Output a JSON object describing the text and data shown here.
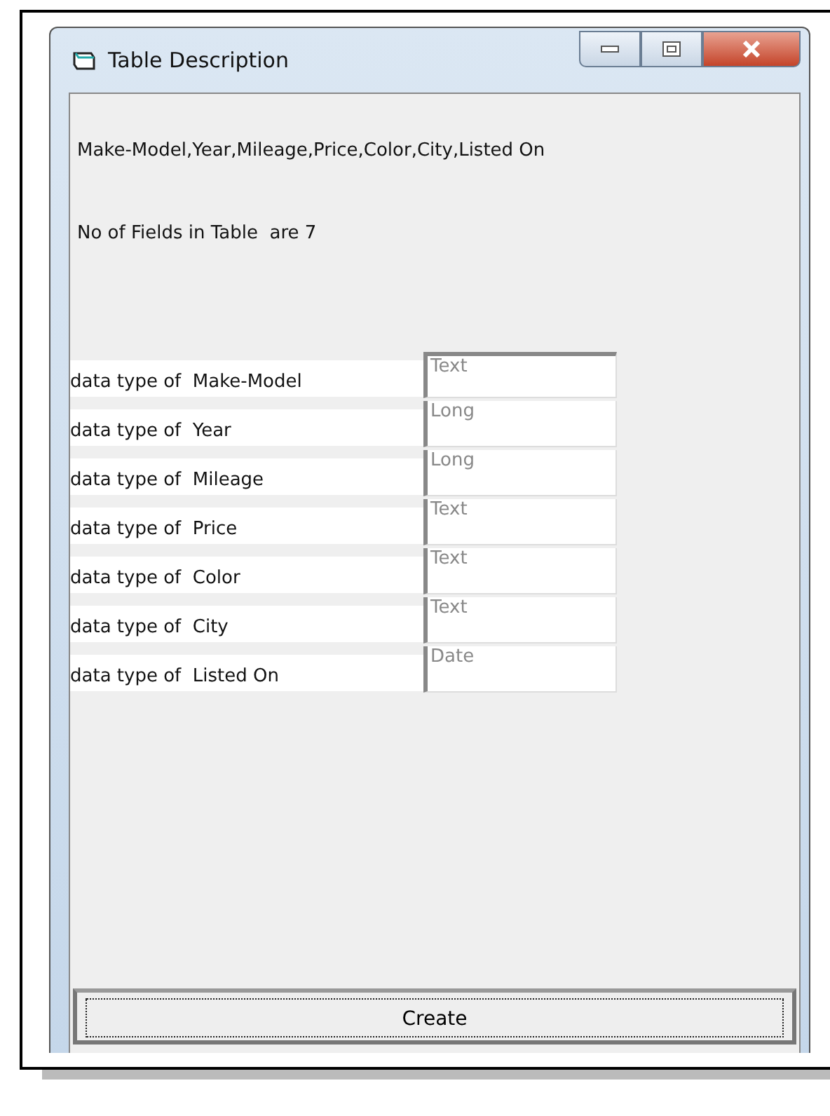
{
  "window": {
    "title": "Table Description"
  },
  "field_list": "Make-Model,Year,Mileage,Price,Color,City,Listed On",
  "field_count": "No of Fields in Table  are 7",
  "fields": [
    {
      "label": "data type of  Make-Model",
      "type": "Text"
    },
    {
      "label": "data type of  Year",
      "type": "Long"
    },
    {
      "label": "data type of  Mileage",
      "type": "Long"
    },
    {
      "label": "data type of  Price",
      "type": "Text"
    },
    {
      "label": "data type of  Color",
      "type": "Text"
    },
    {
      "label": "data type of  City",
      "type": "Text"
    },
    {
      "label": "data type of  Listed On",
      "type": "Date"
    }
  ],
  "buttons": [
    "Create"
  ]
}
